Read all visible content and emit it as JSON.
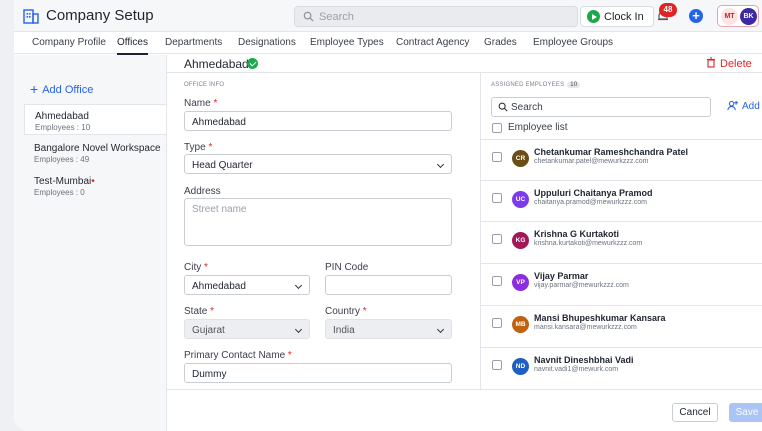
{
  "header": {
    "title": "Company Setup",
    "search_placeholder": "Search",
    "clock_in_label": "Clock In",
    "notification_count": "48",
    "avatars": [
      "MT",
      "BK"
    ],
    "brand_color": "#2563eb"
  },
  "tabs": [
    "Company Profile",
    "Offices",
    "Departments",
    "Designations",
    "Employee Types",
    "Contract Agency",
    "Grades",
    "Employee Groups"
  ],
  "active_tab": "Offices",
  "sidebar": {
    "add_label": "Add Office",
    "offices": [
      {
        "name": "Ahmedabad",
        "count": "Employees : 10",
        "required_dot": ""
      },
      {
        "name": "Bangalore Novel Workspace",
        "count": "Employees : 49",
        "required_dot": ""
      },
      {
        "name": "Test-Mumbai",
        "count": "Employees : 0",
        "required_dot": "•"
      }
    ]
  },
  "office": {
    "title": "Ahmedabad",
    "delete_label": "Delete",
    "section_label": "OFFICE INFO",
    "fields": {
      "name": {
        "label": "Name",
        "value": "Ahmedabad"
      },
      "type": {
        "label": "Type",
        "value": "Head Quarter"
      },
      "address": {
        "label": "Address",
        "placeholder": "Street name"
      },
      "city": {
        "label": "City",
        "value": "Ahmedabad"
      },
      "pin": {
        "label": "PIN Code",
        "value": ""
      },
      "state": {
        "label": "State",
        "value": "Gujarat"
      },
      "country": {
        "label": "Country",
        "value": "India"
      },
      "contact": {
        "label": "Primary Contact Name",
        "value": "Dummy"
      }
    },
    "required_mark": "*"
  },
  "employees": {
    "section_label": "ASSIGNED EMPLOYEES",
    "count": "10",
    "search_placeholder": "Search",
    "add_label": "Add",
    "list_label": "Employee list",
    "items": [
      {
        "initials": "CR",
        "name": "Chetankumar Rameshchandra Patel",
        "email": "chetankumar.patel@mewurkzzz.com",
        "color": "#6b4e16"
      },
      {
        "initials": "UC",
        "name": "Uppuluri Chaitanya Pramod",
        "email": "chaitanya.pramod@mewurkzzz.com",
        "color": "#7c3aed"
      },
      {
        "initials": "KG",
        "name": "Krishna G Kurtakoti",
        "email": "krishna.kurtakoti@mewurkzzz.com",
        "color": "#a3165a"
      },
      {
        "initials": "VP",
        "name": "Vijay Parmar",
        "email": "vijay.parmar@mewurkzzz.com",
        "color": "#8b2ee0"
      },
      {
        "initials": "MB",
        "name": "Mansi Bhupeshkumar Kansara",
        "email": "mansi.kansara@mewurkzzz.com",
        "color": "#c2620e"
      },
      {
        "initials": "ND",
        "name": "Navnit Dineshbhai Vadi",
        "email": "navnit.vadi1@mewurk.com",
        "color": "#1d5fc4"
      }
    ]
  },
  "footer": {
    "cancel_label": "Cancel",
    "save_label": "Save"
  }
}
